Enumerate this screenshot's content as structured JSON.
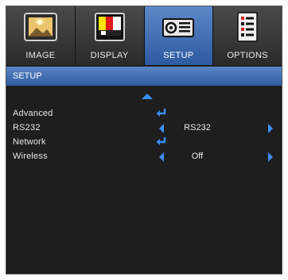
{
  "tabs": [
    {
      "label": "IMAGE",
      "icon": "image-icon"
    },
    {
      "label": "DISPLAY",
      "icon": "display-icon"
    },
    {
      "label": "SETUP",
      "icon": "projector-icon",
      "active": true
    },
    {
      "label": "OPTIONS",
      "icon": "options-icon"
    }
  ],
  "section": {
    "title": "SETUP"
  },
  "menu": {
    "items": [
      {
        "label": "Advanced",
        "control": "enter"
      },
      {
        "label": "RS232",
        "control": "select",
        "value": "RS232"
      },
      {
        "label": "Network",
        "control": "enter"
      },
      {
        "label": "Wireless",
        "control": "select",
        "value": "Off"
      }
    ]
  },
  "colors": {
    "accent_blue": "#3a8ef5",
    "active_tab": "#4a78bc",
    "background": "#1e1e1e"
  }
}
